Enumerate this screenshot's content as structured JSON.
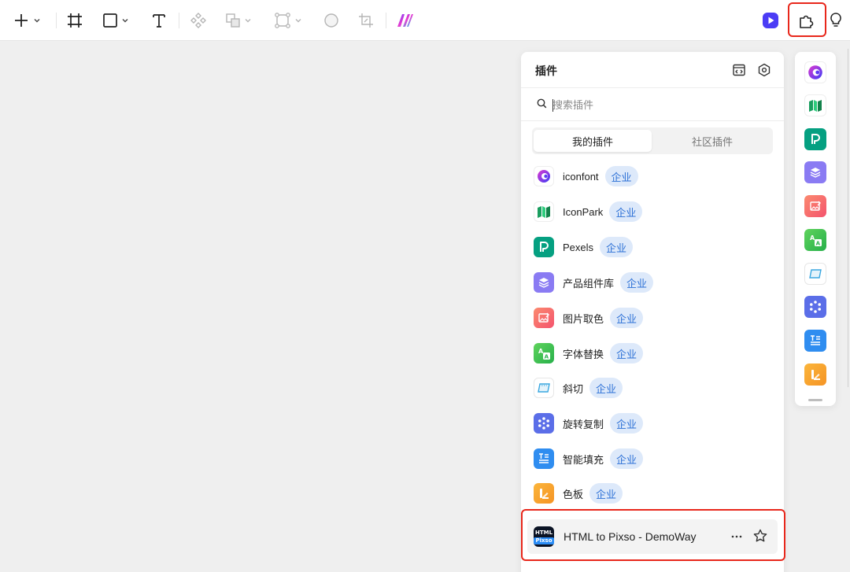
{
  "toolbar": {
    "icons": [
      "plus-icon",
      "frame-icon",
      "rectangle-icon",
      "text-icon",
      "component-icon",
      "boolean-icon",
      "vector-network-icon",
      "ellipse-icon",
      "crop-icon",
      "ai-logo-icon",
      "play-icon",
      "plugin-icon",
      "lightbulb-icon"
    ]
  },
  "panel": {
    "title": "插件",
    "search": {
      "placeholder": "搜索插件",
      "value": ""
    },
    "tabs": [
      {
        "label": "我的插件",
        "active": true
      },
      {
        "label": "社区插件",
        "active": false
      }
    ],
    "badge_label": "企业",
    "plugins": [
      {
        "name": "iconfont",
        "icon": "iconfont-icon",
        "color": "#6a3cf2"
      },
      {
        "name": "IconPark",
        "icon": "iconpark-icon",
        "color": "#17b26a"
      },
      {
        "name": "Pexels",
        "icon": "pexels-icon",
        "color": "#05a081"
      },
      {
        "name": "产品组件库",
        "icon": "layers-icon",
        "color": "#7b6cf0"
      },
      {
        "name": "图片取色",
        "icon": "image-picker-icon",
        "color": "#f46a5e"
      },
      {
        "name": "字体替换",
        "icon": "font-replace-icon",
        "color": "#3bc04a"
      },
      {
        "name": "斜切",
        "icon": "skew-icon",
        "color": "#3aa7e0"
      },
      {
        "name": "旋转复制",
        "icon": "rotate-copy-icon",
        "color": "#5b6ee8"
      },
      {
        "name": "智能填充",
        "icon": "smart-fill-icon",
        "color": "#2f8df0"
      },
      {
        "name": "色板",
        "icon": "palette-icon",
        "color": "#f7a72c"
      }
    ],
    "featured": {
      "name": "HTML to Pixso - DemoWay",
      "icon_text_top": "HTML",
      "icon_text_bottom": "Pixso"
    }
  },
  "dock": {
    "items": [
      "iconfont-icon",
      "iconpark-icon",
      "pexels-icon",
      "layers-icon",
      "image-picker-icon",
      "font-replace-icon",
      "skew-icon",
      "rotate-copy-icon",
      "smart-fill-icon",
      "palette-icon"
    ]
  },
  "colors": {
    "highlight": "#e8271b",
    "badge_bg": "#dde9fa",
    "badge_text": "#2c70d6",
    "accent_play": "#4b3cf5"
  }
}
